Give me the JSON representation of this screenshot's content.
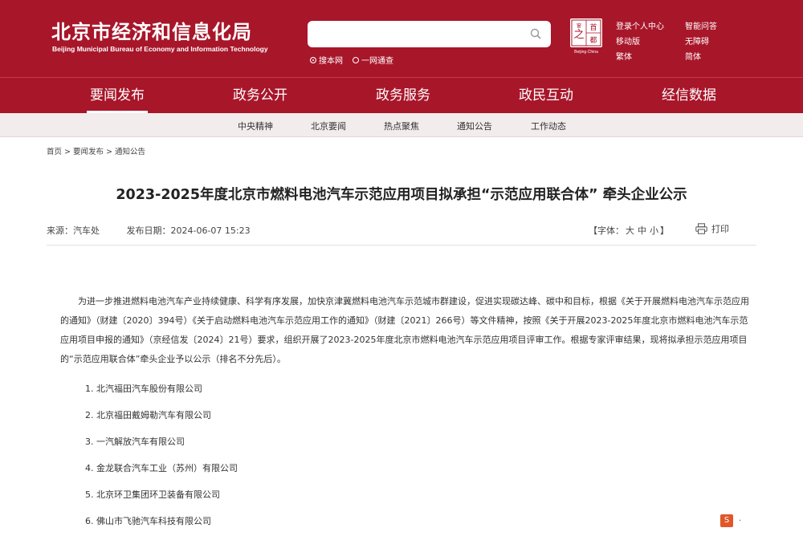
{
  "header": {
    "org_cn": "北京市经济和信息化局",
    "org_en": "Beijing Municipal Bureau of Economy and Information Technology",
    "search_placeholder": "",
    "search_options": [
      "搜本网",
      "一网通查"
    ],
    "seal": {
      "chars": [
        "之",
        "首",
        "都",
        "窗"
      ],
      "caption": "Beijing·China"
    },
    "top_links": [
      "登录个人中心",
      "智能问答",
      "移动版",
      "无障碍",
      "繁体",
      "简体"
    ]
  },
  "nav": {
    "items": [
      "要闻发布",
      "政务公开",
      "政务服务",
      "政民互动",
      "经信数据"
    ],
    "active_index": 0
  },
  "subnav": {
    "items": [
      "中央精神",
      "北京要闻",
      "热点聚焦",
      "通知公告",
      "工作动态"
    ]
  },
  "breadcrumb": "首页 > 要闻发布 > 通知公告",
  "article": {
    "title": "2023-2025年度北京市燃料电池汽车示范应用项目拟承担“示范应用联合体” 牵头企业公示",
    "source_label": "来源：",
    "source": "汽车处",
    "date_label": "发布日期：",
    "date": "2024-06-07 15:23",
    "font_label": "【字体：",
    "font_sizes": [
      "大",
      "中",
      "小"
    ],
    "font_end": "】",
    "print_label": "打印",
    "paragraph": "为进一步推进燃料电池汽车产业持续健康、科学有序发展，加快京津冀燃料电池汽车示范城市群建设，促进实现碳达峰、碳中和目标，根据《关于开展燃料电池汽车示范应用的通知》（财建〔2020〕394号）《关于启动燃料电池汽车示范应用工作的通知》（财建〔2021〕266号）等文件精神，按照《关于开展2023-2025年度北京市燃料电池汽车示范应用项目申报的通知》（京经信发〔2024〕21号）要求，组织开展了2023-2025年度北京市燃料电池汽车示范应用项目评审工作。根据专家评审结果，现将拟承担示范应用项目的“示范应用联合体”牵头企业予以公示（排名不分先后）。",
    "companies": [
      "1. 北汽福田汽车股份有限公司",
      "2. 北京福田戴姆勒汽车有限公司",
      "3. 一汽解放汽车有限公司",
      "4. 金龙联合汽车工业（苏州）有限公司",
      "5. 北京环卫集团环卫装备有限公司",
      "6. 佛山市飞驰汽车科技有限公司"
    ]
  },
  "float_widget": {
    "icon": "S",
    "dots": "·"
  }
}
